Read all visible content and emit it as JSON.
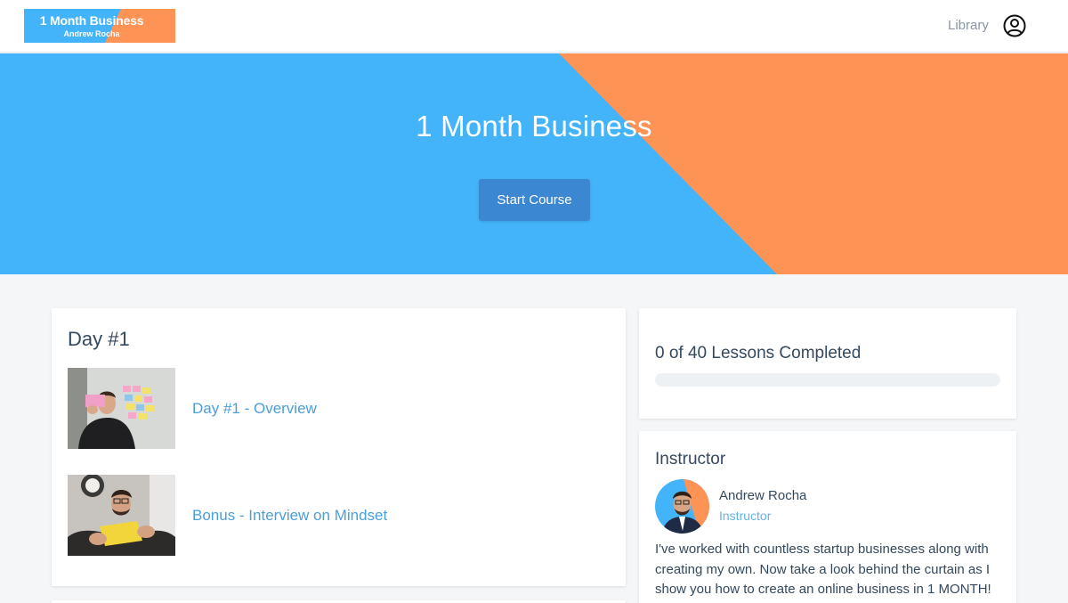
{
  "header": {
    "logo_title": "1 Month Business",
    "logo_subtitle": "Andrew Rocha",
    "library_label": "Library",
    "account_icon": "user-circle-icon"
  },
  "hero": {
    "title": "1 Month Business",
    "start_button": "Start Course",
    "colors": {
      "blue": "#43b4f9",
      "orange": "#fe9356"
    }
  },
  "sections": [
    {
      "title": "Day #1",
      "lessons": [
        {
          "title": "Day #1 - Overview",
          "thumbnail": "man-holding-sticky-note"
        },
        {
          "title": "Bonus - Interview on Mindset",
          "thumbnail": "man-holding-bonus-sign"
        }
      ]
    }
  ],
  "progress": {
    "text": "0 of 40 Lessons Completed",
    "completed": 0,
    "total": 40
  },
  "instructor": {
    "heading": "Instructor",
    "name": "Andrew Rocha",
    "role": "Instructor",
    "bio": "I've worked with countless startup businesses along with creating my own. Now take a look behind the curtain as I show you how to create an online business in 1 MONTH!"
  }
}
